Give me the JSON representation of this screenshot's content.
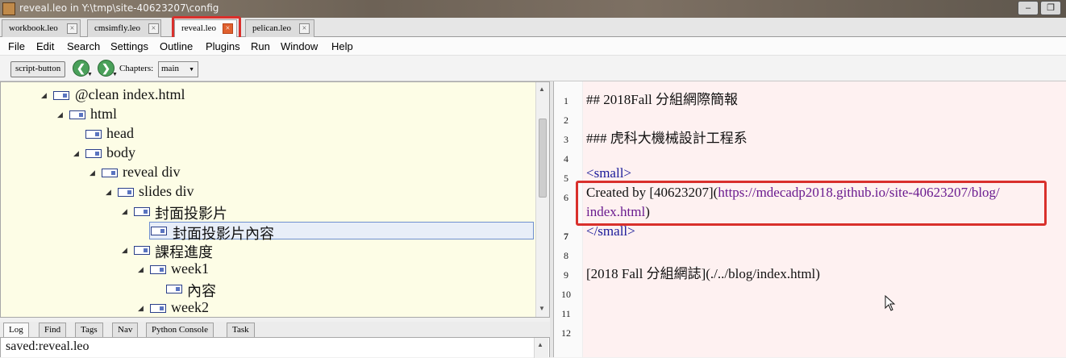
{
  "window": {
    "title": "reveal.leo in Y:\\tmp\\site-40623207\\config",
    "minimize_glyph": "‒",
    "restore_glyph": "❐"
  },
  "tabs": [
    {
      "label": "workbook.leo",
      "close": "×"
    },
    {
      "label": "cmsimfly.leo",
      "close": "×"
    },
    {
      "label": "reveal.leo",
      "close": "×"
    },
    {
      "label": "pelican.leo",
      "close": "×"
    }
  ],
  "menu": [
    "File",
    "Edit",
    "Search",
    "Settings",
    "Outline",
    "Plugins",
    "Run",
    "Window",
    "Help"
  ],
  "toolbar": {
    "script_button": "script-button",
    "back_glyph": "❮",
    "forward_glyph": "❯",
    "dropdown_glyph": "▼",
    "chapters_label": "Chapters:",
    "chapter_value": "main"
  },
  "outline": {
    "nodes": [
      {
        "label": "@clean index.html",
        "expanded": true
      },
      {
        "label": "html",
        "expanded": true
      },
      {
        "label": "head",
        "expanded": false
      },
      {
        "label": "body",
        "expanded": true
      },
      {
        "label": "reveal div",
        "expanded": true
      },
      {
        "label": "slides div",
        "expanded": true
      },
      {
        "label": "封面投影片",
        "expanded": true
      },
      {
        "label": "封面投影片內容",
        "expanded": false,
        "selected": true
      },
      {
        "label": "課程進度",
        "expanded": true
      },
      {
        "label": "week1",
        "expanded": true
      },
      {
        "label": "內容",
        "expanded": false
      },
      {
        "label": "week2",
        "expanded": true
      }
    ],
    "expanded_glyph": "◢",
    "scroll_up_glyph": "▲",
    "scroll_down_glyph": "▼"
  },
  "log": {
    "tabs": [
      "Log",
      "Find",
      "Tags",
      "Nav",
      "Python Console",
      "Task"
    ],
    "text": "saved:reveal.leo"
  },
  "editor": {
    "line_numbers": [
      "1",
      "2",
      "3",
      "4",
      "5",
      "6",
      "",
      "7",
      "8",
      "9",
      "10",
      "11",
      "12"
    ],
    "lines": {
      "l1": "## 2018Fall 分組網際簡報",
      "l3": "### 虎科大機械設計工程系",
      "l5": "<small>",
      "l6_prefix": "Created by [40623207](",
      "l6_link": "https://mdecadp2018.github.io/site-40623207/blog/",
      "l6_cont": "index.html",
      "l6_suffix": ")",
      "l7": "</small>",
      "l9": "[2018 Fall 分組網誌](./../blog/index.html)"
    }
  },
  "colors": {
    "highlight_box": "#d9302c",
    "editor_bg": "#fef1f1",
    "outline_bg": "#fdfde6",
    "tag_color": "#1a1a9a",
    "link_color": "#6a1b8f"
  }
}
